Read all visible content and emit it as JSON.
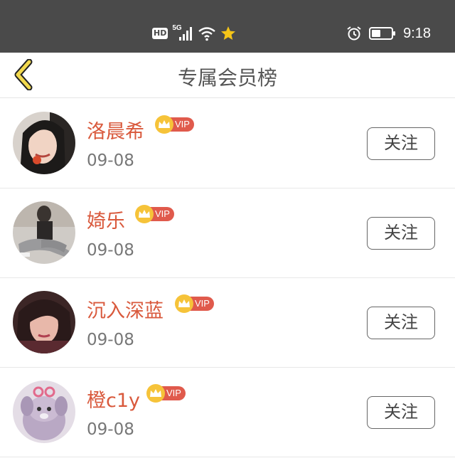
{
  "status_bar": {
    "hd_label": "HD",
    "network_label": "5G",
    "time": "9:18",
    "icons": [
      "signal-icon",
      "wifi-icon",
      "star-notification-icon",
      "alarm-icon",
      "battery-icon"
    ]
  },
  "header": {
    "title": "专属会员榜",
    "back_icon": "chevron-left-icon",
    "accent_color": "#f2d94e"
  },
  "members": [
    {
      "name": "洛晨希",
      "badge": "VIP",
      "date": "09-08",
      "follow_label": "关注"
    },
    {
      "name": "婍乐",
      "badge": "VIP",
      "date": "09-08",
      "follow_label": "关注"
    },
    {
      "name": "沉入深蓝",
      "badge": "VIP",
      "date": "09-08",
      "follow_label": "关注"
    },
    {
      "name": "橙c1y",
      "badge": "VIP",
      "date": "09-08",
      "follow_label": "关注"
    }
  ],
  "colors": {
    "status_bar_bg": "#4a4a4a",
    "name_color": "#d9593c",
    "vip_badge": "#e05a4c",
    "crown": "#f6c339"
  }
}
